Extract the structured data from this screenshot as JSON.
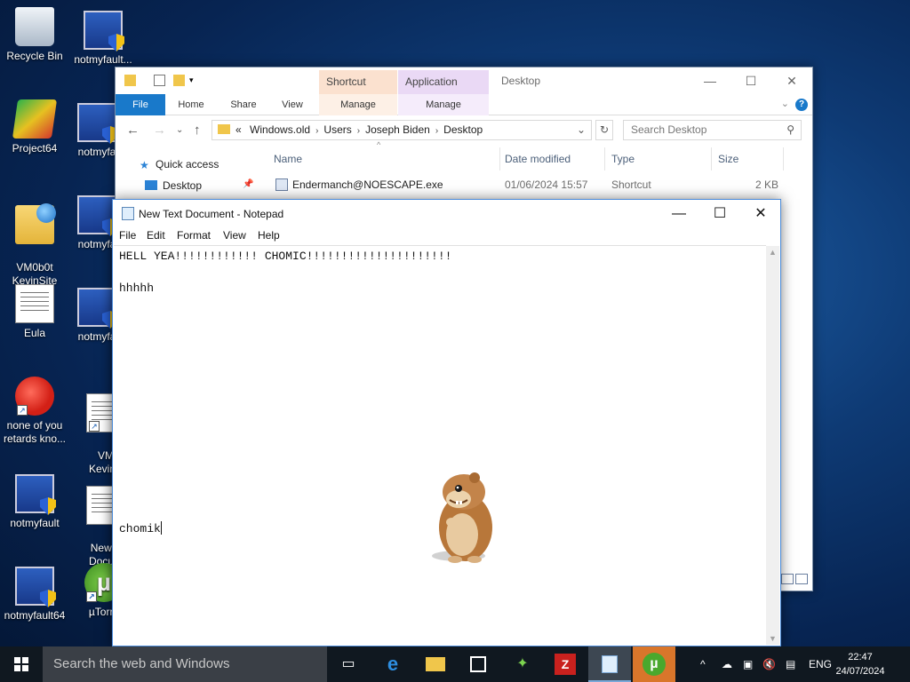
{
  "desktop": {
    "icons": [
      {
        "label": "Recycle Bin"
      },
      {
        "label": "notmyfault..."
      },
      {
        "label": "Project64"
      },
      {
        "label": "notmyfa"
      },
      {
        "label": "VM0b0t\nKevinSite"
      },
      {
        "label": "notmyfa"
      },
      {
        "label": "Eula"
      },
      {
        "label": "notmyfa"
      },
      {
        "label": "none of you retards kno..."
      },
      {
        "label": "VM\nKevinS"
      },
      {
        "label": "notmyfault"
      },
      {
        "label": "New T\nDocum"
      },
      {
        "label": "notmyfault64"
      },
      {
        "label": "µTorre"
      }
    ]
  },
  "explorer": {
    "title": "Desktop",
    "context_tabs": {
      "shortcut_tools": "Shortcut Tools",
      "application_tools": "Application Tools"
    },
    "ribbon_tabs": [
      "File",
      "Home",
      "Share",
      "View",
      "Manage",
      "Manage"
    ],
    "address": {
      "prefix": "«",
      "segments": [
        "Windows.old",
        "Users",
        "Joseph Biden",
        "Desktop"
      ]
    },
    "search_placeholder": "Search Desktop",
    "nav": {
      "quick_access": "Quick access",
      "desktop": "Desktop"
    },
    "columns": {
      "name": "Name",
      "date": "Date modified",
      "type": "Type",
      "size": "Size"
    },
    "files": [
      {
        "name": "Endermanch@NOESCAPE.exe",
        "date": "01/06/2024 15:57",
        "type": "Shortcut",
        "size": "2 KB"
      }
    ],
    "colors": {
      "file_tab": "#1979ca",
      "shortcut_tools": "#fbe1cf",
      "application_tools": "#ead9f5"
    }
  },
  "notepad": {
    "title": "New Text Document - Notepad",
    "menu": [
      "File",
      "Edit",
      "Format",
      "View",
      "Help"
    ],
    "lines": {
      "line1": "HELL YEA!!!!!!!!!!!! CHOMIC!!!!!!!!!!!!!!!!!!!!!",
      "line2": "hhhhh",
      "line3": "chomik"
    }
  },
  "taskbar": {
    "search_placeholder": "Search the web and Windows",
    "apps": [
      "task-view",
      "edge",
      "file-explorer",
      "store",
      "project64",
      "filezilla",
      "notepad",
      "utorrent"
    ],
    "language": "ENG",
    "time": "22:47",
    "date": "24/07/2024"
  }
}
